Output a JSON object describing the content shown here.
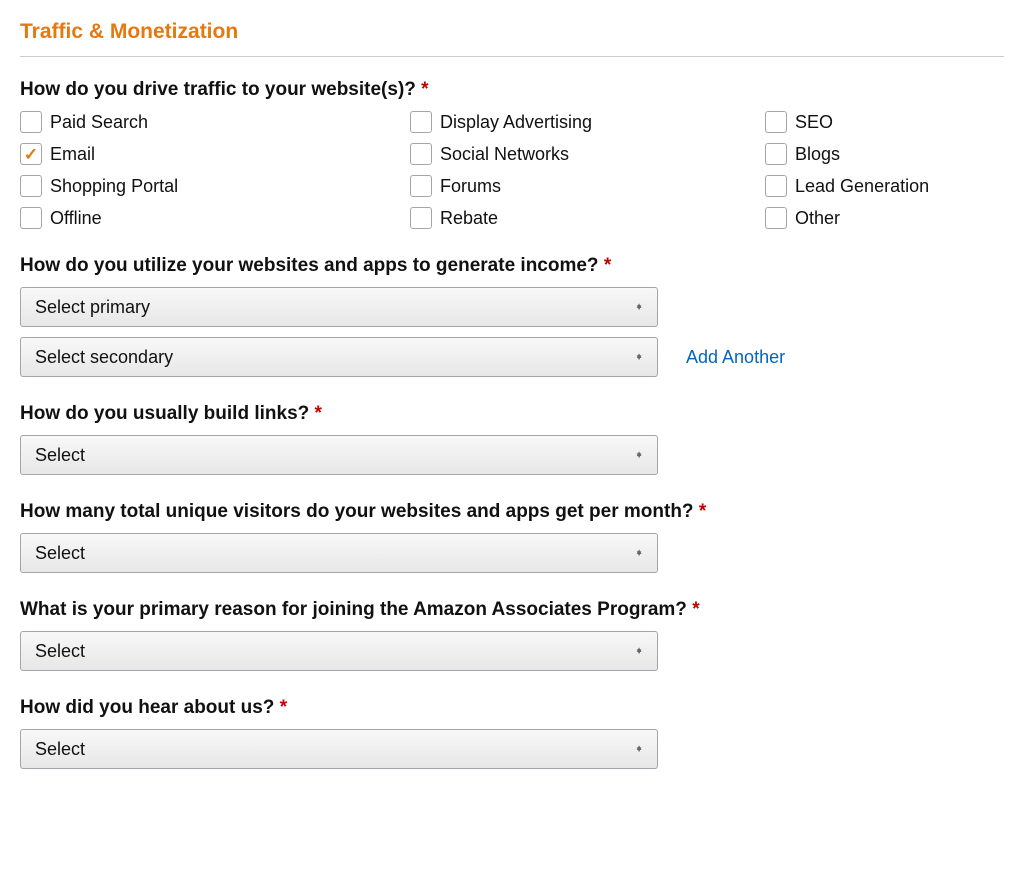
{
  "section_title": "Traffic & Monetization",
  "q_traffic": {
    "label": "How do you drive traffic to your website(s)?",
    "options": [
      {
        "label": "Paid Search",
        "checked": false
      },
      {
        "label": "Display Advertising",
        "checked": false
      },
      {
        "label": "SEO",
        "checked": false
      },
      {
        "label": "Email",
        "checked": true
      },
      {
        "label": "Social Networks",
        "checked": false
      },
      {
        "label": "Blogs",
        "checked": false
      },
      {
        "label": "Shopping Portal",
        "checked": false
      },
      {
        "label": "Forums",
        "checked": false
      },
      {
        "label": "Lead Generation",
        "checked": false
      },
      {
        "label": "Offline",
        "checked": false
      },
      {
        "label": "Rebate",
        "checked": false
      },
      {
        "label": "Other",
        "checked": false
      }
    ]
  },
  "q_income": {
    "label": "How do you utilize your websites and apps to generate income?",
    "primary_placeholder": "Select primary",
    "secondary_placeholder": "Select secondary",
    "add_another": "Add Another"
  },
  "q_links": {
    "label": "How do you usually build links?",
    "placeholder": "Select"
  },
  "q_visitors": {
    "label": "How many total unique visitors do your websites and apps get per month?",
    "placeholder": "Select"
  },
  "q_reason": {
    "label": "What is your primary reason for joining the Amazon Associates Program?",
    "placeholder": "Select"
  },
  "q_hear": {
    "label": "How did you hear about us?",
    "placeholder": "Select"
  },
  "asterisk": "*"
}
